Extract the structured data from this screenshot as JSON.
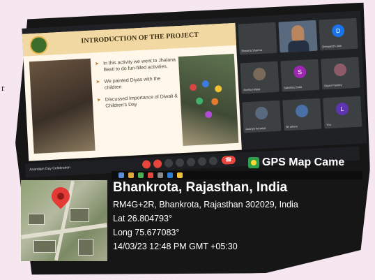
{
  "side_text": "r",
  "slide": {
    "title": "INTRODUCTION OF THE PROJECT",
    "bullets": [
      "In this activity we went to Jhalana Basti to do fun-filled activities.",
      "We painted Diyas with the children",
      "Discussed Importance of Diwali & Children's Day"
    ]
  },
  "participants": [
    {
      "name": "Bhawna Sharma",
      "initial": "",
      "color": "#3c4043"
    },
    {
      "name": "",
      "initial": "",
      "color": "#5a6a7e"
    },
    {
      "name": "Deepanshi Jain",
      "initial": "D",
      "color": "#1a73e8"
    },
    {
      "name": "Reeha Hilalat",
      "initial": "",
      "color": "#7a6a5a"
    },
    {
      "name": "Sakshita Dutta",
      "initial": "S",
      "color": "#9c27b0"
    },
    {
      "name": "Diya's Pandey",
      "initial": "",
      "color": "#8e5b6b"
    },
    {
      "name": "Ananya Acharya",
      "initial": "",
      "color": "#5a6a7e"
    },
    {
      "name": "66 others",
      "initial": "",
      "color": "#3c4043"
    },
    {
      "name": "You",
      "initial": "L",
      "color": "#5e35b1"
    }
  ],
  "meeting_name": "Anandam Day Celebration",
  "gps": {
    "app_title": "GPS Map Came",
    "place": "Bhankrota, Rajasthan, India",
    "address": "RM4G+2R, Bhankrota, Rajasthan 302029, India",
    "lat": "Lat 26.804793°",
    "long": "Long 75.677083°",
    "datetime": "14/03/23 12:48 PM GMT +05:30"
  }
}
